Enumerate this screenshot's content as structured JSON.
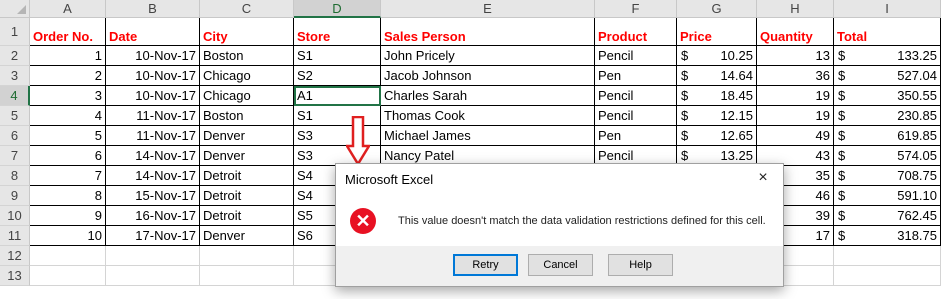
{
  "columns": [
    "A",
    "B",
    "C",
    "D",
    "E",
    "F",
    "G",
    "H",
    "I"
  ],
  "row_numbers": [
    "1",
    "2",
    "3",
    "4",
    "5",
    "6",
    "7",
    "8",
    "9",
    "10",
    "11",
    "12",
    "13"
  ],
  "headers": [
    "Order No.",
    "Date",
    "City",
    "Store",
    "Sales Person",
    "Product",
    "Price",
    "Quantity",
    "Total"
  ],
  "rows": [
    {
      "order": "1",
      "date": "10-Nov-17",
      "city": "Boston",
      "store": "S1",
      "person": "John Pricely",
      "product": "Pencil",
      "price": "10.25",
      "qty": "13",
      "total": "133.25"
    },
    {
      "order": "2",
      "date": "10-Nov-17",
      "city": "Chicago",
      "store": "S2",
      "person": "Jacob Johnson",
      "product": "Pen",
      "price": "14.64",
      "qty": "36",
      "total": "527.04"
    },
    {
      "order": "3",
      "date": "10-Nov-17",
      "city": "Chicago",
      "store": "A1",
      "person": "Charles Sarah",
      "product": "Pencil",
      "price": "18.45",
      "qty": "19",
      "total": "350.55"
    },
    {
      "order": "4",
      "date": "11-Nov-17",
      "city": "Boston",
      "store": "S1",
      "person": "Thomas Cook",
      "product": "Pencil",
      "price": "12.15",
      "qty": "19",
      "total": "230.85"
    },
    {
      "order": "5",
      "date": "11-Nov-17",
      "city": "Denver",
      "store": "S3",
      "person": "Michael James",
      "product": "Pen",
      "price": "12.65",
      "qty": "49",
      "total": "619.85"
    },
    {
      "order": "6",
      "date": "14-Nov-17",
      "city": "Denver",
      "store": "S3",
      "person": "Nancy Patel",
      "product": "Pencil",
      "price": "13.25",
      "qty": "43",
      "total": "574.05"
    },
    {
      "order": "7",
      "date": "14-Nov-17",
      "city": "Detroit",
      "store": "S4",
      "person": "",
      "product": "",
      "price": "",
      "qty": "35",
      "total": "708.75"
    },
    {
      "order": "8",
      "date": "15-Nov-17",
      "city": "Detroit",
      "store": "S4",
      "person": "",
      "product": "",
      "price": "",
      "qty": "46",
      "total": "591.10"
    },
    {
      "order": "9",
      "date": "16-Nov-17",
      "city": "Detroit",
      "store": "S5",
      "person": "",
      "product": "",
      "price": "",
      "qty": "39",
      "total": "762.45"
    },
    {
      "order": "10",
      "date": "17-Nov-17",
      "city": "Denver",
      "store": "S6",
      "person": "",
      "product": "",
      "price": "",
      "qty": "17",
      "total": "318.75"
    }
  ],
  "currency_symbol": "$",
  "selected_cell": "D4",
  "dialog": {
    "title": "Microsoft Excel",
    "close": "×",
    "icon": "error-icon",
    "message": "This value doesn't match the data validation restrictions defined for this cell.",
    "retry_label": "Retry",
    "cancel_label": "Cancel",
    "help_label": "Help"
  },
  "colors": {
    "header_text": "#ff0000",
    "selection": "#217346",
    "error_icon": "#e81123",
    "arrow": "#e02020"
  }
}
